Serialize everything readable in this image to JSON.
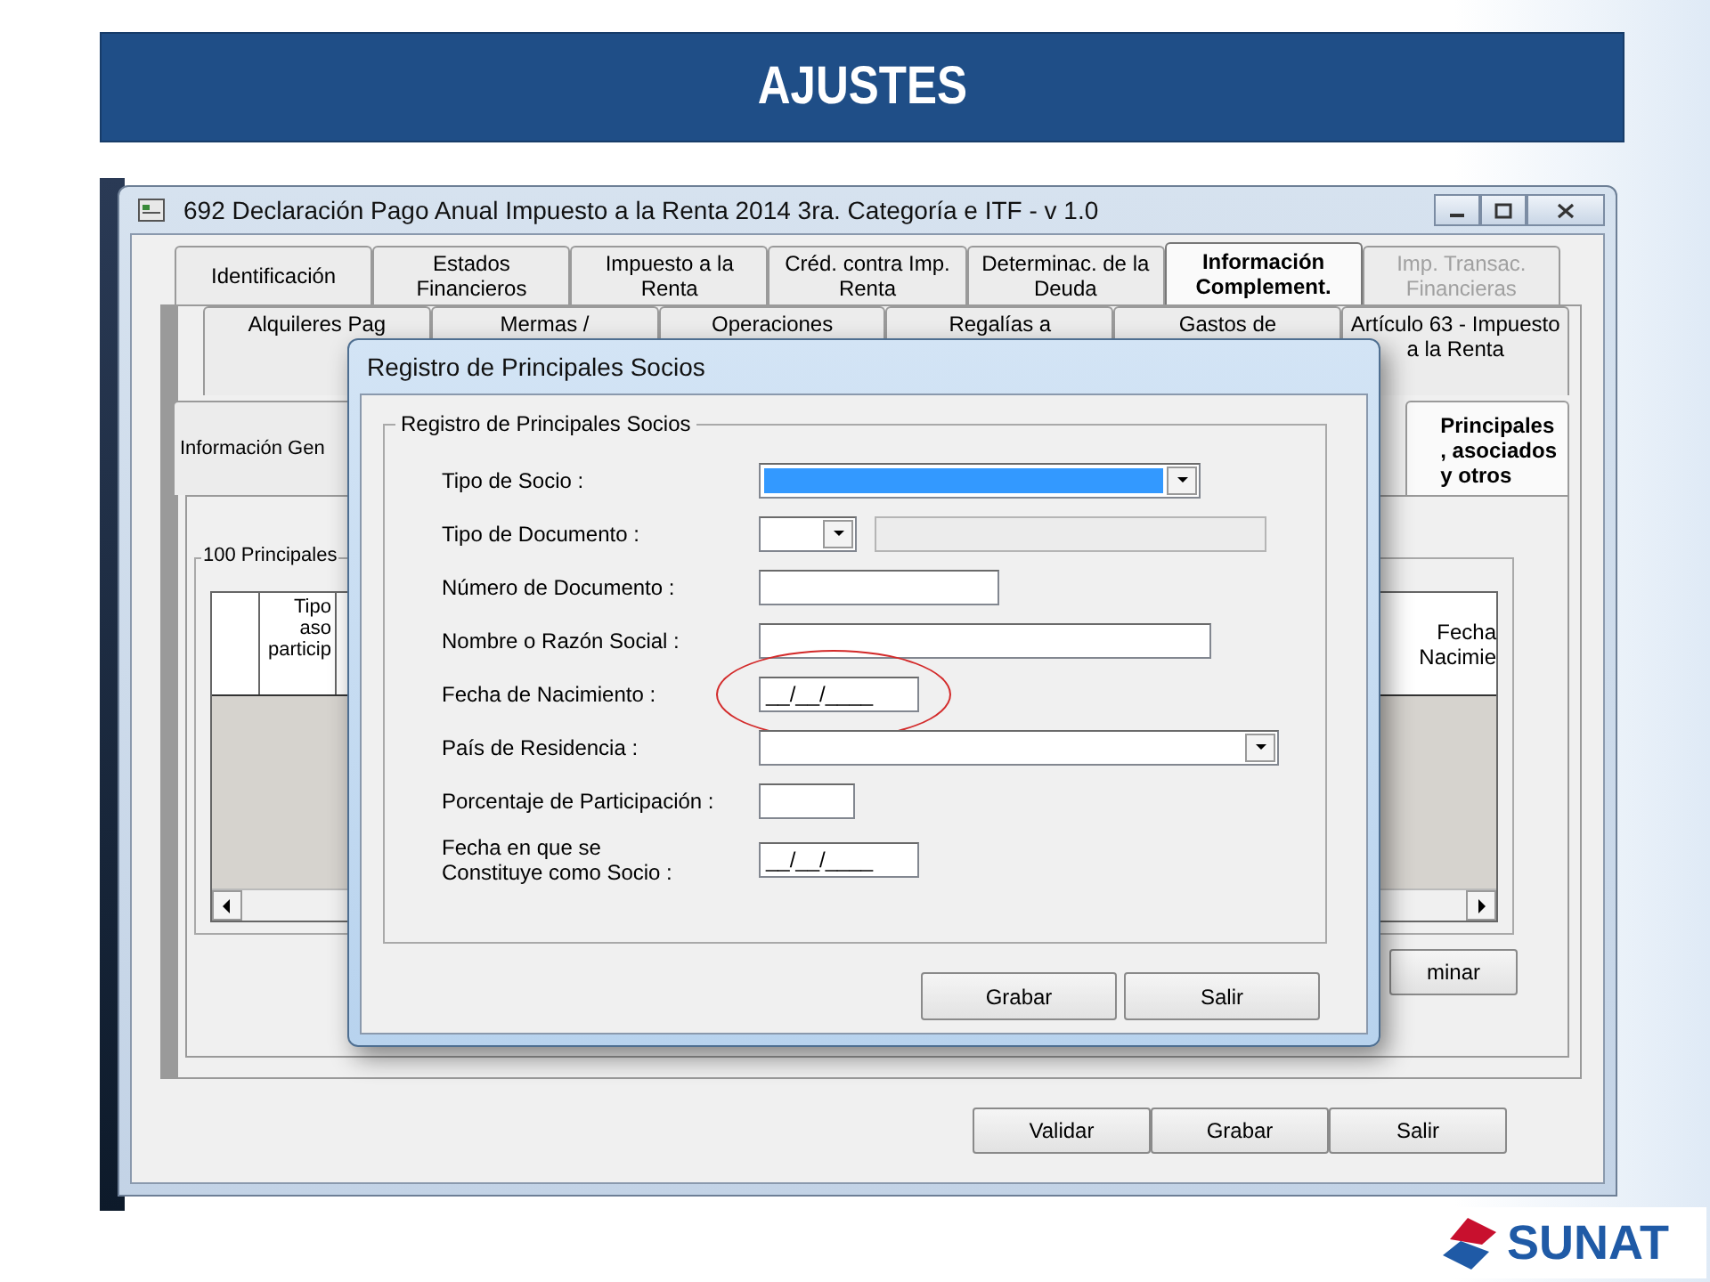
{
  "slide": {
    "title": "AJUSTES",
    "logo": "SUNAT"
  },
  "window": {
    "title": "692 Declaración Pago Anual Impuesto a la Renta 2014 3ra. Categoría e ITF - v 1.0",
    "tabs": [
      {
        "label": "Identificación",
        "selected": false,
        "disabled": false
      },
      {
        "label": "Estados\nFinancieros",
        "selected": false,
        "disabled": false
      },
      {
        "label": "Impuesto a  la\nRenta",
        "selected": false,
        "disabled": false
      },
      {
        "label": "Créd. contra Imp.\nRenta",
        "selected": false,
        "disabled": false
      },
      {
        "label": "Determinac. de la\nDeuda",
        "selected": false,
        "disabled": false
      },
      {
        "label": "Información\nComplement.",
        "selected": true,
        "disabled": false
      },
      {
        "label": "Imp. Transac.\nFinancieras",
        "selected": false,
        "disabled": true
      }
    ],
    "subtabs": [
      {
        "label": "Alquileres Pag"
      },
      {
        "label": "Mermas /"
      },
      {
        "label": "Operaciones"
      },
      {
        "label": "Regalías a"
      },
      {
        "label": "Gastos de"
      },
      {
        "label": "Artículo 63 - Impuesto\na la Renta"
      }
    ],
    "section_tabs": [
      {
        "label": "Información Gen",
        "selected": false
      },
      {
        "label": "Principales\n, asociados\ny otros",
        "selected": true
      }
    ],
    "group": {
      "title": "100 Principales",
      "columns": [
        {
          "label": "Tipo\naso\nparticip"
        },
        {
          "label": "Fecha\nNacimie"
        }
      ]
    },
    "side_button": "minar",
    "buttons": [
      "Validar",
      "Grabar",
      "Salir"
    ]
  },
  "dialog": {
    "title": "Registro de Principales Socios",
    "group_title": "Registro de Principales Socios",
    "fields": [
      {
        "label": "Tipo de Socio :",
        "kind": "combo",
        "highlighted": true,
        "circled": false
      },
      {
        "label": "Tipo de Documento :",
        "kind": "combo_field",
        "highlighted": false,
        "circled": false
      },
      {
        "label": "Número de Documento :",
        "kind": "text",
        "circled": false
      },
      {
        "label": "Nombre o Razón Social :",
        "kind": "text",
        "circled": false
      },
      {
        "label": "Fecha de Nacimiento :",
        "kind": "date",
        "value": "__/__/____",
        "circled": true
      },
      {
        "label": "País de Residencia :",
        "kind": "combo",
        "highlighted": false,
        "circled": false
      },
      {
        "label": "Porcentaje de Participación :",
        "kind": "text",
        "circled": false
      },
      {
        "label": "Fecha en que se\nConstituye como Socio :",
        "kind": "date",
        "value": "__/__/____",
        "circled": false
      }
    ],
    "buttons": [
      "Grabar",
      "Salir"
    ]
  }
}
